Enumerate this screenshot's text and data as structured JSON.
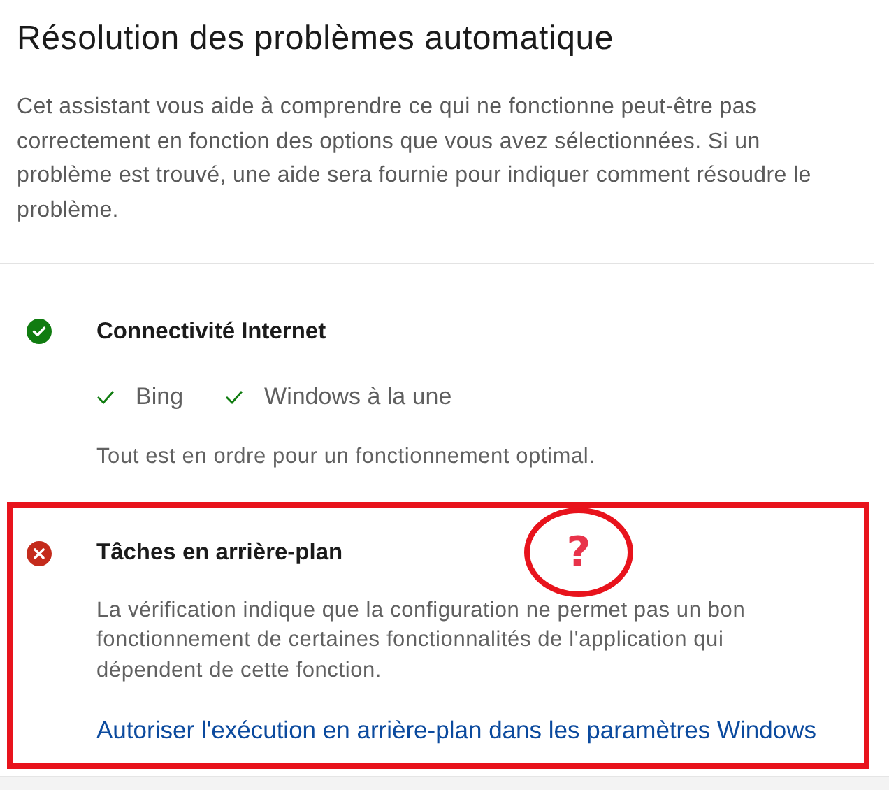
{
  "title": "Résolution des problèmes automatique",
  "description": "Cet assistant vous aide à comprendre ce qui ne fonctionne peut-être pas correctement en fonction des options que vous avez sélectionnées. Si un problème est trouvé, une aide sera fournie pour indiquer comment résoudre le problème.",
  "checks": [
    {
      "kind": "success",
      "title": "Connectivité Internet",
      "items": [
        {
          "label": "Bing",
          "passed": true
        },
        {
          "label": "Windows à la une",
          "passed": true
        }
      ],
      "message": "Tout est en ordre pour un fonctionnement optimal."
    },
    {
      "kind": "error",
      "title": "Tâches en arrière-plan",
      "message": "La vérification indique que la configuration ne permet pas un bon fonctionnement de certaines fonctionnalités de l'application qui dépendent de cette fonction.",
      "link": "Autoriser l'exécution en arrière-plan dans les paramètres Windows"
    }
  ],
  "annotation": {
    "mark": "?"
  }
}
